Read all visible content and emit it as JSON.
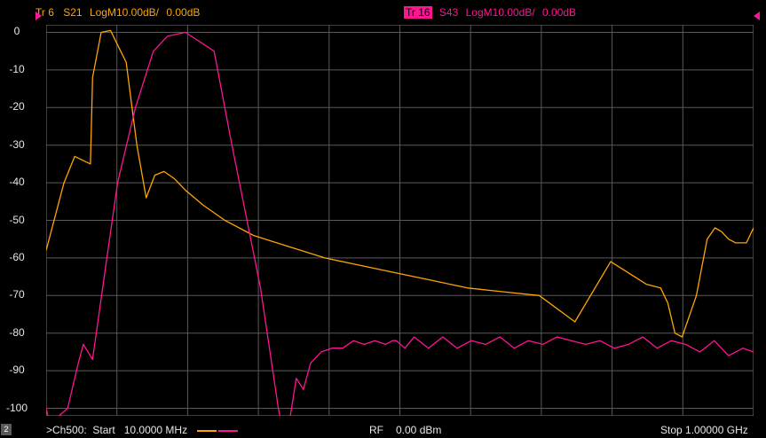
{
  "window": {
    "channel_badge": "2"
  },
  "traces": [
    {
      "tag": "Tr 6",
      "param": "S21",
      "format": "LogM",
      "scale": "10.00dB/",
      "ref": "0.00dB",
      "color": "#ffa500",
      "tag_bg": "transparent",
      "tag_fg": "#ffa500"
    },
    {
      "tag": "Tr 16",
      "param": "S43",
      "format": "LogM",
      "scale": "10.00dB/",
      "ref": "0.00dB",
      "color": "#ff1493",
      "tag_bg": "#ff1493",
      "tag_fg": "#000000"
    }
  ],
  "y_axis": {
    "labels": [
      "0",
      "-10",
      "-20",
      "-30",
      "-40",
      "-50",
      "-60",
      "-70",
      "-80",
      "-90",
      "-100"
    ]
  },
  "status_bar": {
    "channel_text": ">Ch500:  Start   10.0000 MHz",
    "rf_label": "RF",
    "rf_value": "0.00 dBm",
    "stop_text": "Stop  1.00000 GHz"
  },
  "chart_data": {
    "type": "line",
    "x_range_mhz": [
      10,
      1000
    ],
    "ylim": [
      -102,
      2
    ],
    "y_ticks": [
      0,
      -10,
      -20,
      -30,
      -40,
      -50,
      -60,
      -70,
      -80,
      -90,
      -100
    ],
    "x_divisions": 10,
    "grid": true,
    "series": [
      {
        "name": "S21",
        "color": "#ffa500",
        "x": [
          10,
          35,
          50,
          72,
          75,
          87,
          100,
          122,
          137,
          150,
          162,
          175,
          190,
          205,
          230,
          260,
          300,
          350,
          400,
          450,
          500,
          550,
          600,
          650,
          700,
          750,
          800,
          850,
          870,
          880,
          890,
          900,
          920,
          935,
          946,
          955,
          965,
          975,
          990,
          1000
        ],
        "y": [
          -58,
          -40,
          -33,
          -35,
          -12,
          0,
          0.5,
          -8,
          -30,
          -44,
          -38,
          -37,
          -39,
          -42,
          -46,
          -50,
          -54,
          -57,
          -60,
          -62,
          -64,
          -66,
          -68,
          -69,
          -70,
          -77,
          -61,
          -67,
          -68,
          -72,
          -80,
          -81,
          -70,
          -55,
          -52,
          -53,
          -55,
          -56,
          -56,
          -52
        ]
      },
      {
        "name": "S43",
        "color": "#ff1493",
        "x": [
          10,
          15,
          28,
          40,
          55,
          62,
          75,
          95,
          110,
          135,
          160,
          180,
          205,
          245,
          270,
          310,
          335,
          345,
          360,
          370,
          380,
          395,
          410,
          425,
          440,
          455,
          470,
          485,
          495,
          500,
          512,
          525,
          545,
          565,
          585,
          605,
          625,
          645,
          665,
          685,
          705,
          725,
          745,
          765,
          785,
          805,
          825,
          845,
          865,
          885,
          905,
          925,
          945,
          965,
          985,
          1000
        ],
        "y": [
          -100,
          -104,
          -102,
          -100,
          -88,
          -83,
          -87,
          -60,
          -40,
          -20,
          -5,
          -1,
          0,
          -5,
          -30,
          -68,
          -100,
          -110,
          -92,
          -95,
          -88,
          -85,
          -84,
          -84,
          -82,
          -83,
          -82,
          -83,
          -82,
          -82,
          -84,
          -81,
          -84,
          -81,
          -84,
          -82,
          -83,
          -81,
          -84,
          -82,
          -83,
          -81,
          -82,
          -83,
          -82,
          -84,
          -83,
          -81,
          -84,
          -82,
          -83,
          -85,
          -82,
          -86,
          -84,
          -85
        ]
      }
    ]
  }
}
